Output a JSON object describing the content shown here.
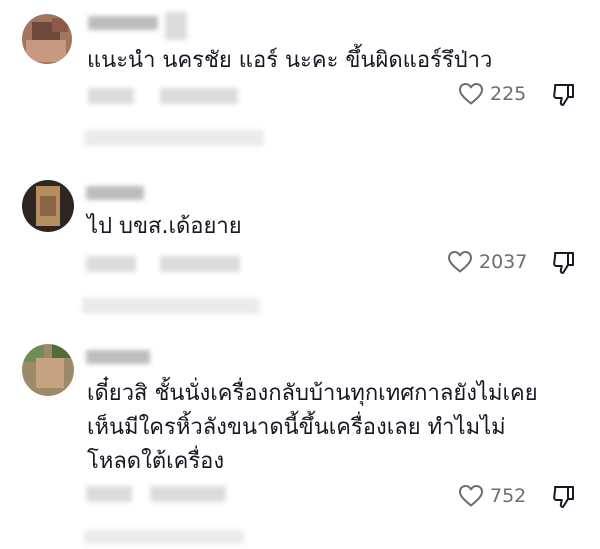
{
  "comments": [
    {
      "text": "แนะนำ นครชัย แอร์ นะคะ ขึ้นผิดแอร์รึป่าว",
      "likes": "225"
    },
    {
      "text": "ไป บขส.เด้อยาย",
      "likes": "2037"
    },
    {
      "text": "เดี๋ยวสิ ชั้นนั่งเครื่องกลับบ้านทุกเทศกาลยังไม่เคย\nเห็นมีใครหิ้วลังขนาดนี้ขึ้นเครื่องเลย ทำไมไม่\nโหลดใต้เครื่อง",
      "likes": "752"
    }
  ],
  "icons": {
    "like": "heart-outline-icon",
    "dislike": "thumbs-down-icon"
  },
  "colors": {
    "text": "#161823",
    "muted": "#6b6d73",
    "blur": "#dcdcdc"
  }
}
